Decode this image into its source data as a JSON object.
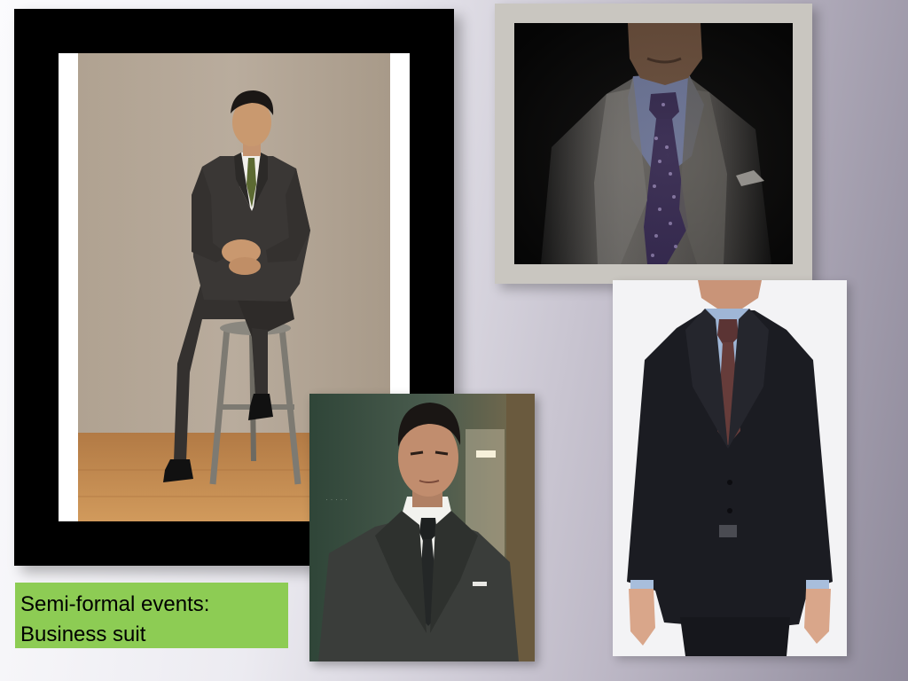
{
  "caption": {
    "line1": "Semi-formal events:",
    "line2": "Business suit"
  },
  "photos": [
    {
      "name": "seated-man-business-suit"
    },
    {
      "name": "closeup-suit-purple-tie"
    },
    {
      "name": "standing-man-navy-suit"
    },
    {
      "name": "man-in-office-grey-suit"
    }
  ],
  "colors": {
    "caption_background": "#8dcc54",
    "frame_black": "#000000",
    "frame_grey": "#c9c6c0"
  }
}
